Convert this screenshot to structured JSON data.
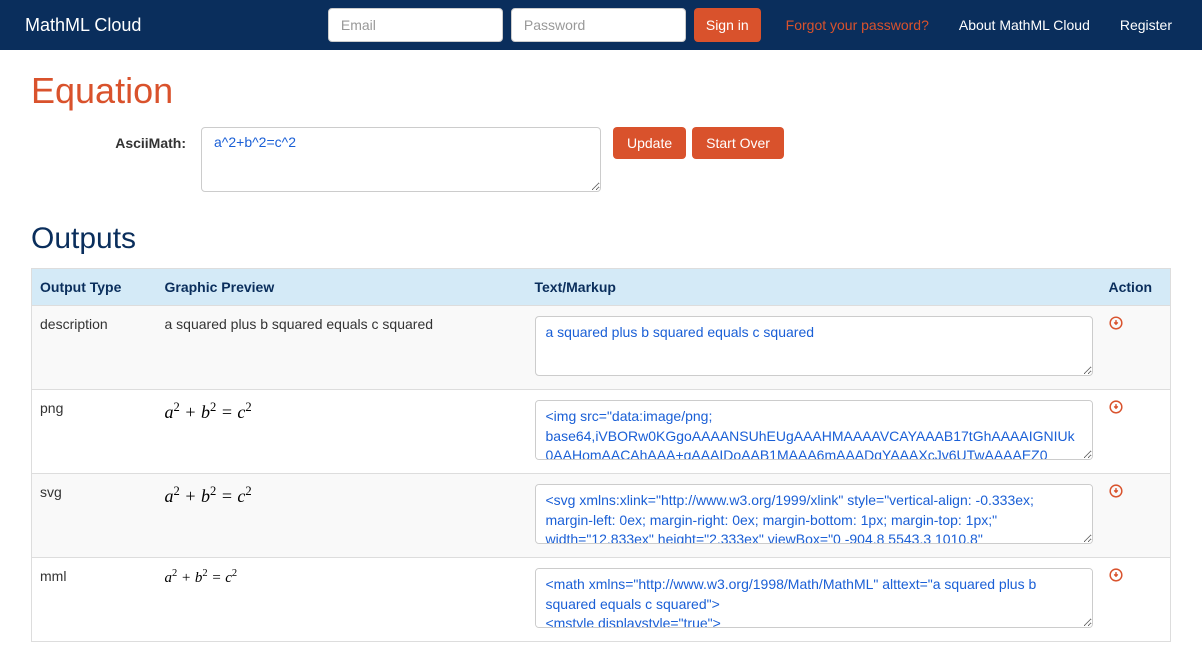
{
  "navbar": {
    "brand": "MathML Cloud",
    "email_placeholder": "Email",
    "password_placeholder": "Password",
    "signin_label": "Sign in",
    "forgot_label": "Forgot your password?",
    "about_label": "About MathML Cloud",
    "register_label": "Register"
  },
  "equation": {
    "title": "Equation",
    "label": "AsciiMath:",
    "value": "a^2+b^2=c^2",
    "update_label": "Update",
    "startover_label": "Start Over"
  },
  "outputs": {
    "title": "Outputs",
    "headers": {
      "type": "Output Type",
      "preview": "Graphic Preview",
      "markup": "Text/Markup",
      "action": "Action"
    },
    "rows": [
      {
        "type": "description",
        "preview_text": "a squared plus b squared equals c squared",
        "markup": "a squared plus b squared equals c squared"
      },
      {
        "type": "png",
        "preview_text": "",
        "markup": "<img src=\"data:image/png;\nbase64,iVBORw0KGgoAAAANSUhEUgAAAHMAAAAVCAYAAAB17tGhAAAAIGNIUk0AAHomAACAhAAA+gAAAIDoAAB1MAAA6mAAADqYAAAXcJv6UTwAAAAEZ0"
      },
      {
        "type": "svg",
        "preview_text": "",
        "markup": "<svg xmlns:xlink=\"http://www.w3.org/1999/xlink\" style=\"vertical-align: -0.333ex; margin-left: 0ex; margin-right: 0ex; margin-bottom: 1px; margin-top: 1px;\" width=\"12.833ex\" height=\"2.333ex\" viewBox=\"0 -904.8 5543.3 1010.8\""
      },
      {
        "type": "mml",
        "preview_text": "",
        "markup": "<math xmlns=\"http://www.w3.org/1998/Math/MathML\" alttext=\"a squared plus b squared equals c squared\">\n<mstyle displaystyle=\"true\">"
      }
    ]
  }
}
